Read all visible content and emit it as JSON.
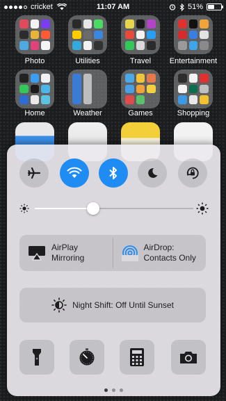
{
  "status_bar": {
    "carrier": "cricket",
    "time": "11:07 AM",
    "battery": "51%",
    "battery_level": 0.51,
    "signal_bars": 4,
    "signal_total": 5
  },
  "home": {
    "folders": [
      {
        "label": "Photo"
      },
      {
        "label": "Utilities"
      },
      {
        "label": "Travel"
      },
      {
        "label": "Entertainment"
      },
      {
        "label": "Home"
      },
      {
        "label": "Weather"
      },
      {
        "label": "Games"
      },
      {
        "label": "Shopping"
      }
    ],
    "dock_icons": [
      "calendar-icon",
      "wallet-icon",
      "notes-icon",
      "gmail-icon"
    ]
  },
  "control_center": {
    "toggles": [
      {
        "name": "airplane-mode",
        "icon": "airplane-icon",
        "on": false
      },
      {
        "name": "wifi",
        "icon": "wifi-icon",
        "on": true
      },
      {
        "name": "bluetooth",
        "icon": "bluetooth-icon",
        "on": true
      },
      {
        "name": "do-not-disturb",
        "icon": "moon-icon",
        "on": false
      },
      {
        "name": "rotation-lock",
        "icon": "rotation-lock-icon",
        "on": false
      }
    ],
    "brightness": 0.37,
    "airplay": {
      "line1": "AirPlay",
      "line2": "Mirroring"
    },
    "airdrop": {
      "line1": "AirDrop:",
      "line2": "Contacts Only"
    },
    "night_shift": "Night Shift: Off Until Sunset",
    "shortcuts": [
      "flashlight-icon",
      "timer-icon",
      "calculator-icon",
      "camera-icon"
    ],
    "page_count": 3,
    "active_page": 1
  },
  "colors": {
    "accent": "#1f8cf4",
    "panel": "#ece9ee"
  }
}
